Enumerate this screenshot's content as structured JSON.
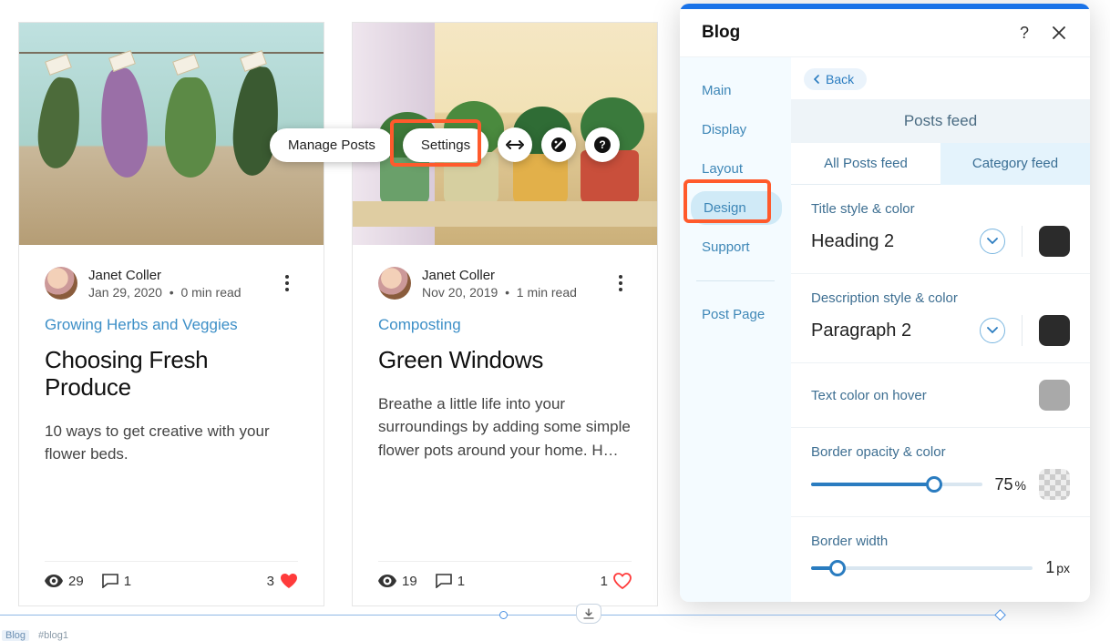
{
  "toolbar": {
    "manage_posts": "Manage Posts",
    "settings": "Settings"
  },
  "posts": [
    {
      "author": "Janet Coller",
      "date": "Jan 29, 2020",
      "read_time": "0 min read",
      "category": "Growing Herbs and Veggies",
      "title": "Choosing Fresh Produce",
      "excerpt": "10 ways to get creative with your flower beds.",
      "views": "29",
      "comments": "1",
      "likes": "3",
      "liked": true
    },
    {
      "author": "Janet Coller",
      "date": "Nov 20, 2019",
      "read_time": "1 min read",
      "category": "Composting",
      "title": "Green Windows",
      "excerpt": "Breathe a little life into your surroundings by adding some simple flower pots around your home. H…",
      "views": "19",
      "comments": "1",
      "likes": "1",
      "liked": false
    }
  ],
  "panel": {
    "title": "Blog",
    "back": "Back",
    "sidebar": {
      "main": "Main",
      "display": "Display",
      "layout": "Layout",
      "design": "Design",
      "support": "Support",
      "post_page": "Post Page"
    },
    "section_heading": "Posts feed",
    "tabs": {
      "all": "All Posts feed",
      "category": "Category feed"
    },
    "options": {
      "title_style_label": "Title style & color",
      "title_style_value": "Heading 2",
      "desc_style_label": "Description style & color",
      "desc_style_value": "Paragraph 2",
      "hover_label": "Text color on hover",
      "border_opacity_label": "Border opacity & color",
      "border_opacity_value": "75",
      "border_opacity_unit": "%",
      "border_width_label": "Border width",
      "border_width_value": "1",
      "border_width_unit": "px"
    }
  },
  "canvas": {
    "element_label": "Blog",
    "element_id": "#blog1"
  },
  "colors": {
    "title_swatch": "#2b2b2b",
    "desc_swatch": "#2b2b2b",
    "hover_swatch": "#a9a9a9"
  }
}
